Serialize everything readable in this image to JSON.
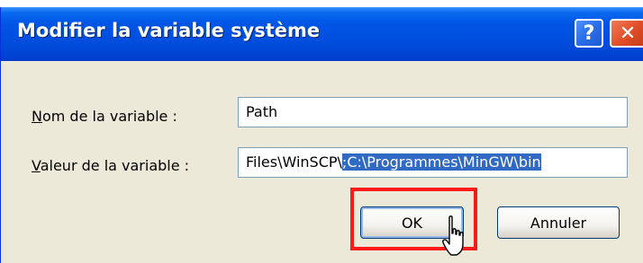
{
  "dialog": {
    "title": "Modifier la variable système",
    "help_button": "?",
    "close_button": "✕"
  },
  "fields": {
    "name_label_access_key": "N",
    "name_label_rest": "om de la variable :",
    "name_value": "Path",
    "value_label_access_key": "V",
    "value_label_rest": "aleur de la variable :",
    "value_visible_text": "Files\\WinSCP\\",
    "value_selected_text": ";C:\\Programmes\\MinGW\\bin"
  },
  "buttons": {
    "ok_label": "OK",
    "cancel_label": "Annuler"
  },
  "colors": {
    "titlebar": "#0055e5",
    "selection": "#316ac5",
    "annotation_box": "#ff1a1a",
    "dialog_face": "#ece9d8"
  },
  "icons": {
    "help": "question-mark-icon",
    "close": "close-x-icon",
    "cursor": "hand-pointer-cursor-icon"
  }
}
